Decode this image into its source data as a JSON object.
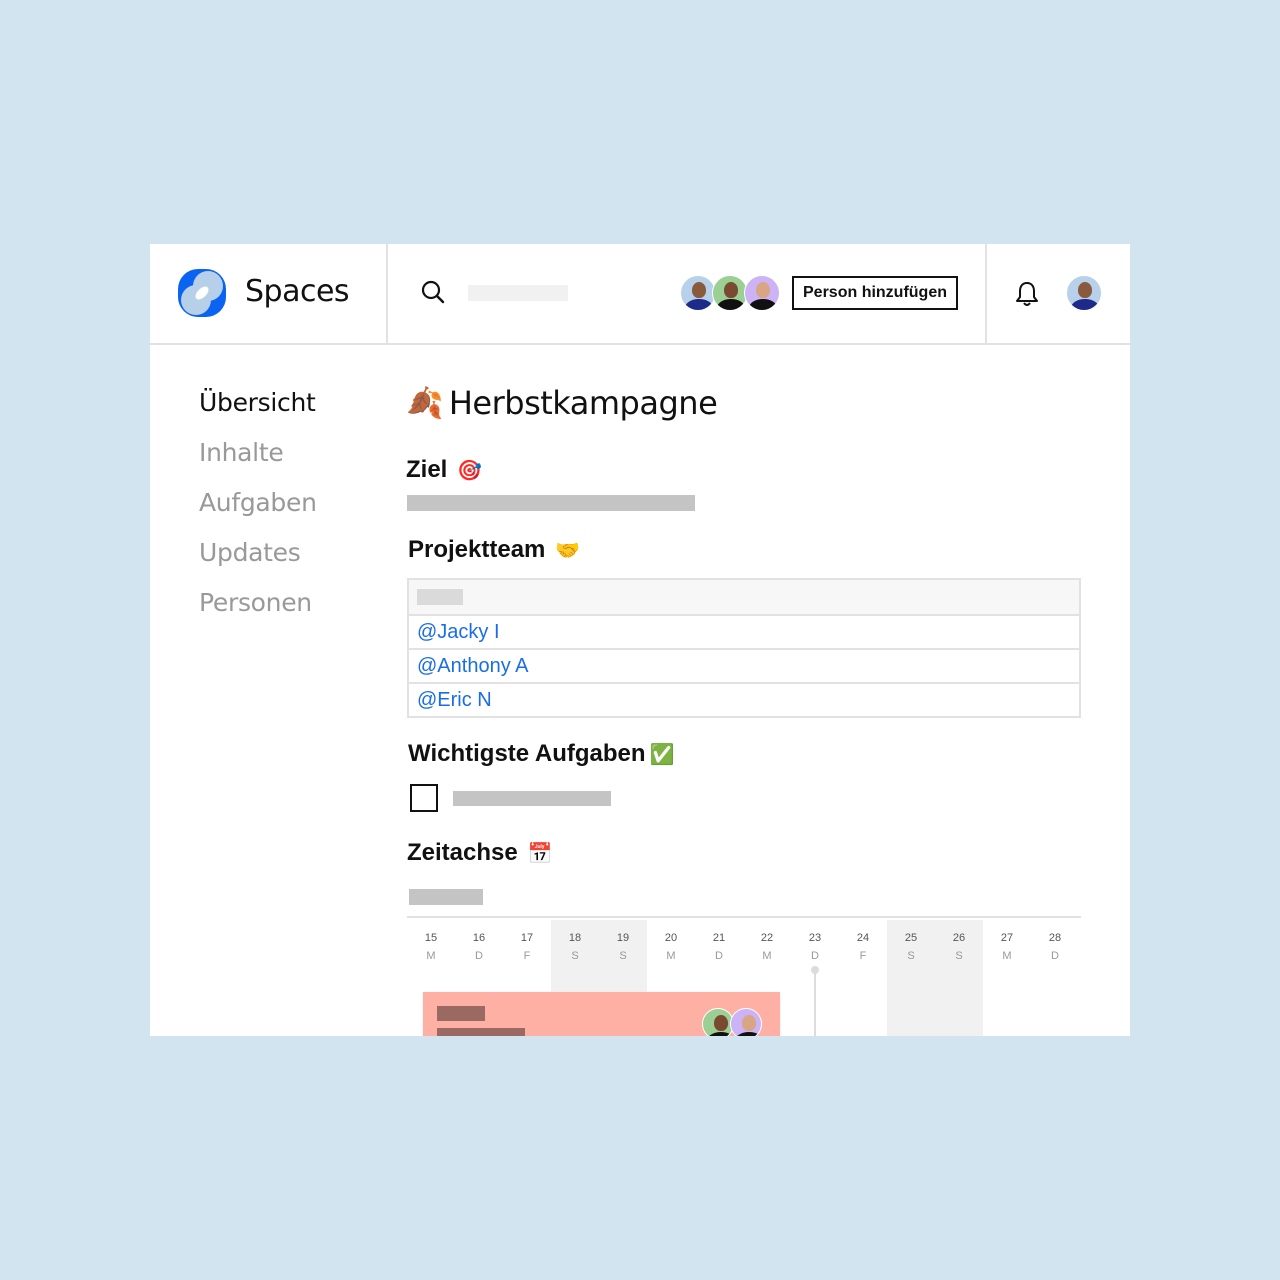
{
  "app": {
    "name": "Spaces"
  },
  "header": {
    "search_placeholder": "",
    "add_person_label": "Person hinzufügen",
    "member_avatars": [
      {
        "name": "Jacky I",
        "bg": "#b7d1ea",
        "skin": "#8a5a3c",
        "shirt": "#1d2a8a"
      },
      {
        "name": "Anthony A",
        "bg": "#9ccf93",
        "skin": "#7a4a30",
        "shirt": "#111111"
      },
      {
        "name": "Eric N",
        "bg": "#cbb3f5",
        "skin": "#d8a684",
        "shirt": "#111111"
      }
    ],
    "notifications_icon": "bell-icon",
    "current_user": {
      "name": "Jacky I",
      "bg": "#b7d1ea",
      "skin": "#8a5a3c",
      "shirt": "#1d2a8a"
    }
  },
  "sidebar": {
    "items": [
      {
        "label": "Übersicht",
        "active": true
      },
      {
        "label": "Inhalte",
        "active": false
      },
      {
        "label": "Aufgaben",
        "active": false
      },
      {
        "label": "Updates",
        "active": false
      },
      {
        "label": "Personen",
        "active": false
      }
    ]
  },
  "page": {
    "title_emoji": "🍂",
    "title": "Herbstkampagne",
    "sections": {
      "goal": {
        "title": "Ziel",
        "emoji": "🎯"
      },
      "team": {
        "title": "Projektteam",
        "emoji": "🤝",
        "members": [
          "@Jacky I",
          "@Anthony A",
          "@Eric N"
        ]
      },
      "tasks": {
        "title": "Wichtigste Aufgaben",
        "emoji": "✅",
        "items": [
          {
            "checked": false
          }
        ]
      },
      "timeline": {
        "title": "Zeitachse",
        "emoji": "📅",
        "days": [
          {
            "num": "15",
            "wd": "M",
            "weekend": false
          },
          {
            "num": "16",
            "wd": "D",
            "weekend": false
          },
          {
            "num": "17",
            "wd": "F",
            "weekend": false
          },
          {
            "num": "18",
            "wd": "S",
            "weekend": true
          },
          {
            "num": "19",
            "wd": "S",
            "weekend": true
          },
          {
            "num": "20",
            "wd": "M",
            "weekend": false
          },
          {
            "num": "21",
            "wd": "D",
            "weekend": false
          },
          {
            "num": "22",
            "wd": "M",
            "weekend": false
          },
          {
            "num": "23",
            "wd": "D",
            "weekend": false
          },
          {
            "num": "24",
            "wd": "F",
            "weekend": false
          },
          {
            "num": "25",
            "wd": "S",
            "weekend": true
          },
          {
            "num": "26",
            "wd": "S",
            "weekend": true
          },
          {
            "num": "27",
            "wd": "M",
            "weekend": false
          },
          {
            "num": "28",
            "wd": "D",
            "weekend": false
          }
        ],
        "today_marker_day": "23",
        "task_bar": {
          "start_day": "15",
          "end_day": "22",
          "color": "#fdb0a3",
          "assignees": [
            "Anthony A",
            "Eric N"
          ]
        }
      }
    }
  }
}
